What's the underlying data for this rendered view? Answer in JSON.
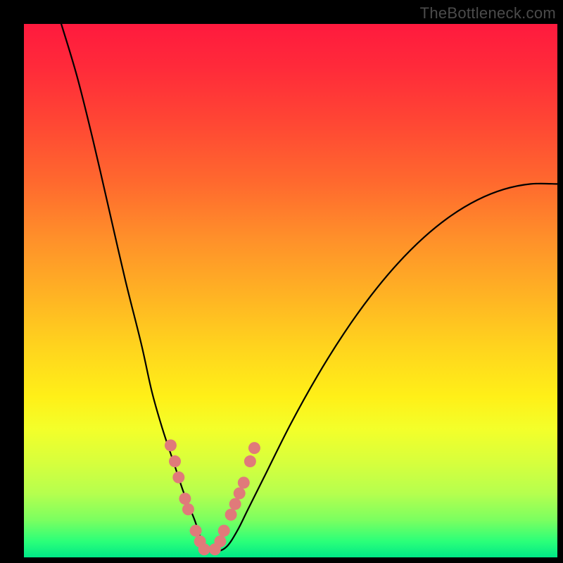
{
  "watermark": "TheBottleneck.com",
  "chart_data": {
    "type": "line",
    "title": "",
    "xlabel": "",
    "ylabel": "",
    "xlim": [
      0,
      100
    ],
    "ylim": [
      0,
      100
    ],
    "grid": false,
    "legend": false,
    "series": [
      {
        "name": "bottleneck-curve",
        "color": "#000000",
        "x": [
          7,
          10,
          13,
          16,
          19,
          22,
          24,
          26,
          28,
          30,
          32,
          33,
          34,
          35,
          36,
          38,
          40,
          42,
          45,
          50,
          55,
          60,
          65,
          70,
          75,
          80,
          85,
          90,
          95,
          100
        ],
        "y": [
          100,
          90,
          78,
          65,
          52,
          40,
          31,
          24,
          18,
          12,
          7,
          4,
          2,
          1,
          1,
          2,
          5,
          9,
          15,
          25,
          34,
          42,
          49,
          55,
          60,
          64,
          67,
          69,
          70,
          70
        ]
      }
    ],
    "highlight_points": {
      "name": "highlight-dots",
      "color": "#e07a7a",
      "x": [
        27.5,
        28.3,
        29.0,
        30.2,
        30.8,
        32.2,
        33.0,
        33.8,
        35.8,
        36.8,
        37.5,
        38.8,
        39.6,
        40.4,
        41.2,
        42.4,
        43.2
      ],
      "y": [
        21.0,
        18.0,
        15.0,
        11.0,
        9.0,
        5.0,
        3.0,
        1.5,
        1.5,
        3.0,
        5.0,
        8.0,
        10.0,
        12.0,
        14.0,
        18.0,
        20.5
      ]
    }
  }
}
